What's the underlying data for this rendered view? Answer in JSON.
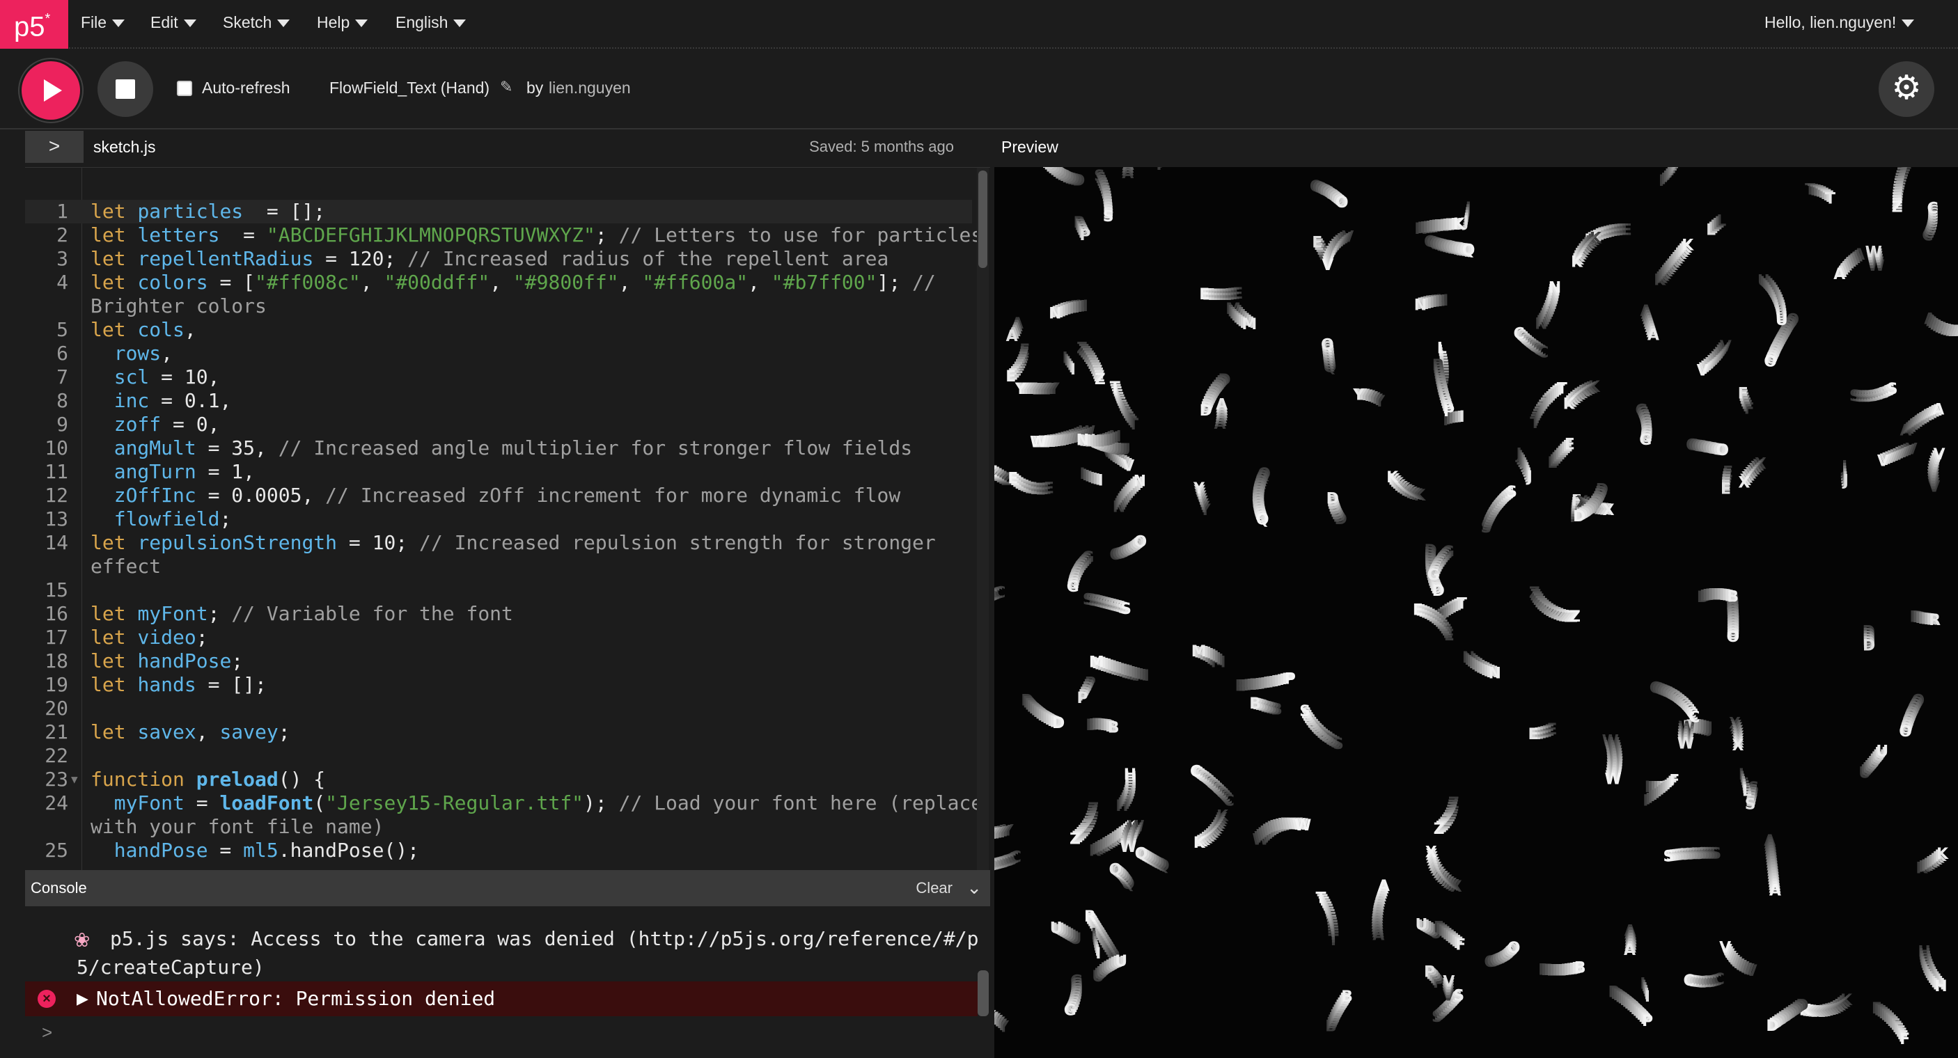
{
  "app": {
    "logo": "p5",
    "logo_mark": "*"
  },
  "menu": [
    {
      "label": "File"
    },
    {
      "label": "Edit"
    },
    {
      "label": "Sketch"
    },
    {
      "label": "Help"
    },
    {
      "label": "English"
    }
  ],
  "user_greeting": "Hello, lien.nguyen!",
  "toolbar": {
    "auto_refresh_label": "Auto-refresh",
    "auto_refresh_checked": false,
    "sketch_name": "FlowField_Text (Hand)",
    "by_label": "by",
    "author": "lien.nguyen"
  },
  "editor": {
    "expand_glyph": ">",
    "filename": "sketch.js",
    "saved_status": "Saved: 5 months ago",
    "preview_label": "Preview"
  },
  "code_lines": [
    {
      "n": "1",
      "tokens": [
        [
          "kw",
          "let "
        ],
        [
          "def",
          "particles"
        ],
        [
          "",
          "  = [];"
        ]
      ]
    },
    {
      "n": "2",
      "tokens": [
        [
          "kw",
          "let "
        ],
        [
          "def",
          "letters"
        ],
        [
          "",
          "  = "
        ],
        [
          "str",
          "\"ABCDEFGHIJKLMNOPQRSTUVWXYZ\""
        ],
        [
          "",
          "; "
        ],
        [
          "cm",
          "// Letters to use for particles"
        ]
      ]
    },
    {
      "n": "3",
      "tokens": [
        [
          "kw",
          "let "
        ],
        [
          "def",
          "repellentRadius"
        ],
        [
          "",
          " = 120; "
        ],
        [
          "cm",
          "// Increased radius of the repellent area"
        ]
      ]
    },
    {
      "n": "4",
      "tokens": [
        [
          "kw",
          "let "
        ],
        [
          "def",
          "colors"
        ],
        [
          "",
          " = ["
        ],
        [
          "str",
          "\"#ff008c\""
        ],
        [
          "",
          ", "
        ],
        [
          "str",
          "\"#00ddff\""
        ],
        [
          "",
          ", "
        ],
        [
          "str",
          "\"#9800ff\""
        ],
        [
          "",
          ", "
        ],
        [
          "str",
          "\"#ff600a\""
        ],
        [
          "",
          ", "
        ],
        [
          "str",
          "\"#b7ff00\""
        ],
        [
          "",
          "]; "
        ],
        [
          "cm",
          "//"
        ]
      ]
    },
    {
      "n": "",
      "tokens": [
        [
          "cm",
          "Brighter colors"
        ]
      ]
    },
    {
      "n": "5",
      "tokens": [
        [
          "kw",
          "let "
        ],
        [
          "def",
          "cols"
        ],
        [
          "",
          ","
        ]
      ]
    },
    {
      "n": "6",
      "tokens": [
        [
          "",
          "  "
        ],
        [
          "def",
          "rows"
        ],
        [
          "",
          ","
        ]
      ]
    },
    {
      "n": "7",
      "tokens": [
        [
          "",
          "  "
        ],
        [
          "def",
          "scl"
        ],
        [
          "",
          " = 10,"
        ]
      ]
    },
    {
      "n": "8",
      "tokens": [
        [
          "",
          "  "
        ],
        [
          "def",
          "inc"
        ],
        [
          "",
          " = 0.1,"
        ]
      ]
    },
    {
      "n": "9",
      "tokens": [
        [
          "",
          "  "
        ],
        [
          "def",
          "zoff"
        ],
        [
          "",
          " = 0,"
        ]
      ]
    },
    {
      "n": "10",
      "tokens": [
        [
          "",
          "  "
        ],
        [
          "def",
          "angMult"
        ],
        [
          "",
          " = 35, "
        ],
        [
          "cm",
          "// Increased angle multiplier for stronger flow fields"
        ]
      ]
    },
    {
      "n": "11",
      "tokens": [
        [
          "",
          "  "
        ],
        [
          "def",
          "angTurn"
        ],
        [
          "",
          " = 1,"
        ]
      ]
    },
    {
      "n": "12",
      "tokens": [
        [
          "",
          "  "
        ],
        [
          "def",
          "zOffInc"
        ],
        [
          "",
          " = 0.0005, "
        ],
        [
          "cm",
          "// Increased zOff increment for more dynamic flow"
        ]
      ]
    },
    {
      "n": "13",
      "tokens": [
        [
          "",
          "  "
        ],
        [
          "def",
          "flowfield"
        ],
        [
          "",
          ";"
        ]
      ]
    },
    {
      "n": "14",
      "tokens": [
        [
          "kw",
          "let "
        ],
        [
          "def",
          "repulsionStrength"
        ],
        [
          "",
          " = 10; "
        ],
        [
          "cm",
          "// Increased repulsion strength for stronger"
        ]
      ]
    },
    {
      "n": "",
      "tokens": [
        [
          "cm",
          "effect"
        ]
      ]
    },
    {
      "n": "15",
      "tokens": []
    },
    {
      "n": "16",
      "tokens": [
        [
          "kw",
          "let "
        ],
        [
          "def",
          "myFont"
        ],
        [
          "",
          "; "
        ],
        [
          "cm",
          "// Variable for the font"
        ]
      ]
    },
    {
      "n": "17",
      "tokens": [
        [
          "kw",
          "let "
        ],
        [
          "def",
          "video"
        ],
        [
          "",
          ";"
        ]
      ]
    },
    {
      "n": "18",
      "tokens": [
        [
          "kw",
          "let "
        ],
        [
          "def",
          "handPose"
        ],
        [
          "",
          ";"
        ]
      ]
    },
    {
      "n": "19",
      "tokens": [
        [
          "kw",
          "let "
        ],
        [
          "def",
          "hands"
        ],
        [
          "",
          " = [];"
        ]
      ]
    },
    {
      "n": "20",
      "tokens": []
    },
    {
      "n": "21",
      "tokens": [
        [
          "kw",
          "let "
        ],
        [
          "def",
          "savex"
        ],
        [
          "",
          ", "
        ],
        [
          "def",
          "savey"
        ],
        [
          "",
          ";"
        ]
      ]
    },
    {
      "n": "22",
      "tokens": []
    },
    {
      "n": "23",
      "tokens": [
        [
          "kw",
          "function "
        ],
        [
          "fn",
          "preload"
        ],
        [
          "",
          "() {"
        ]
      ]
    },
    {
      "n": "24",
      "tokens": [
        [
          "",
          "  "
        ],
        [
          "def",
          "myFont"
        ],
        [
          "",
          " = "
        ],
        [
          "fn",
          "loadFont"
        ],
        [
          "",
          "("
        ],
        [
          "str",
          "\"Jersey15-Regular.ttf\""
        ],
        [
          "",
          "); "
        ],
        [
          "cm",
          "// Load your font here (replace"
        ]
      ]
    },
    {
      "n": "",
      "tokens": [
        [
          "cm",
          "with your font file name)"
        ]
      ]
    },
    {
      "n": "25",
      "tokens": [
        [
          "",
          "  "
        ],
        [
          "def",
          "handPose"
        ],
        [
          "",
          " = "
        ],
        [
          "def",
          "ml5"
        ],
        [
          "",
          ".handPose();"
        ]
      ]
    }
  ],
  "console": {
    "title": "Console",
    "clear_label": "Clear",
    "message_line1": "p5.js says: Access to the camera was denied (http://p5js.org/reference/#/p",
    "message_line2": "5/createCapture)",
    "error": "NotAllowedError: Permission denied",
    "prompt": ">"
  },
  "preview_letters": "ABCDEFGHIJKLMNOPQRSTUVWXYZ"
}
